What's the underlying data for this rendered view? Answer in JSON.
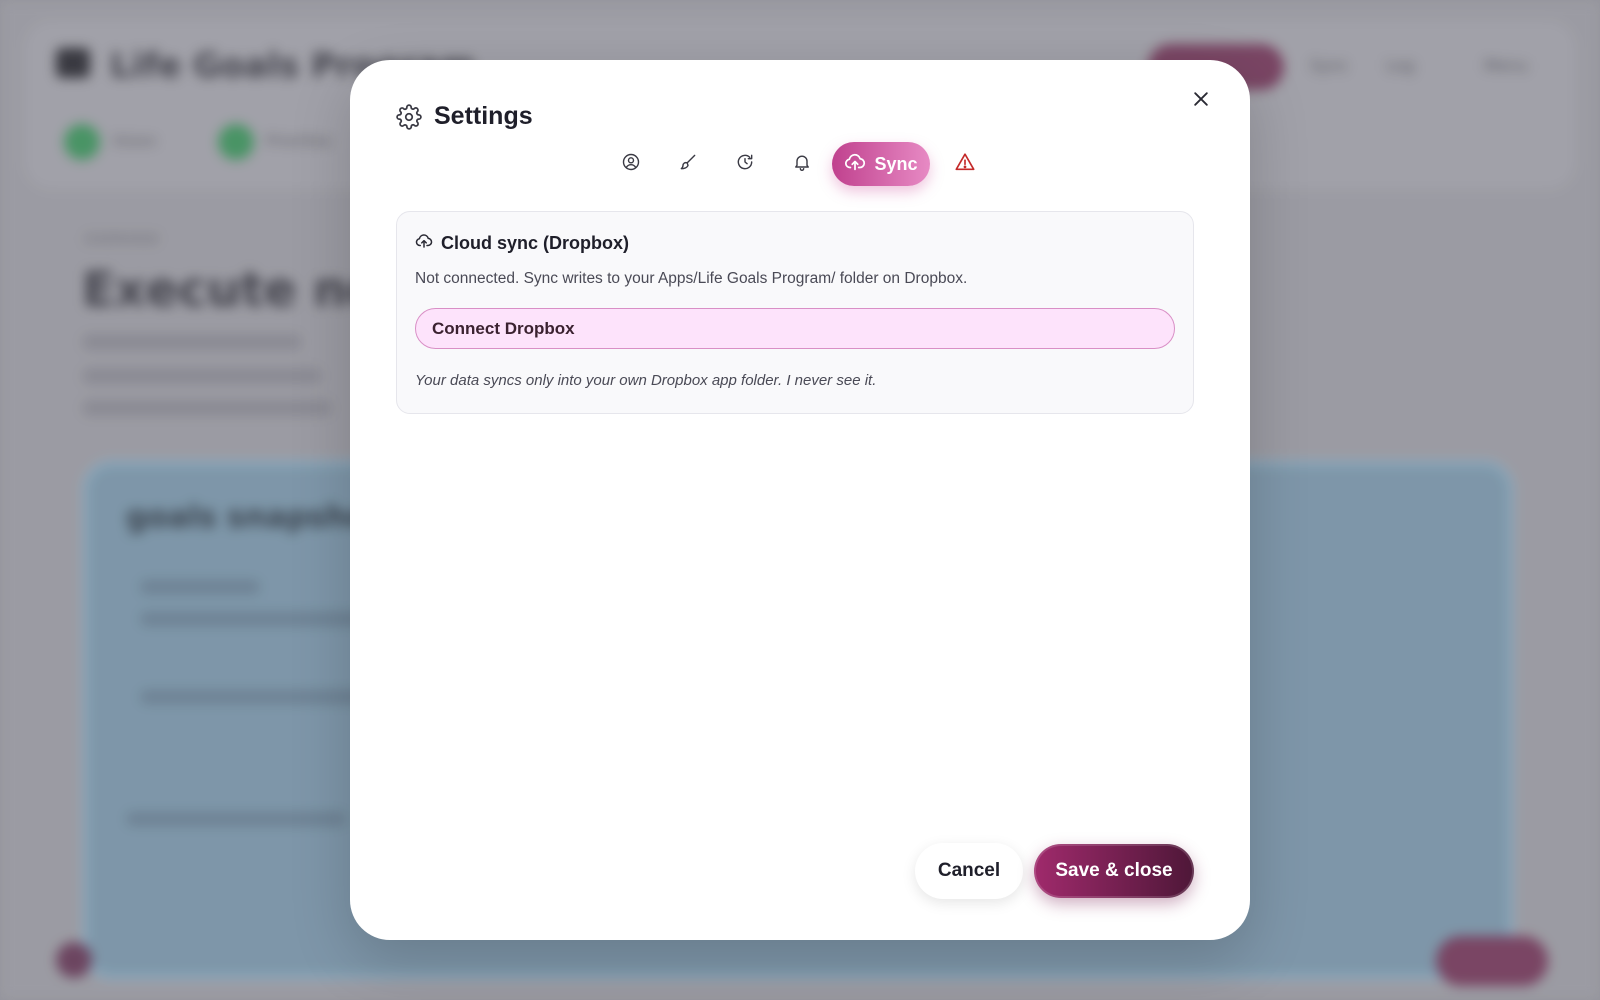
{
  "background": {
    "app_title": "Life Goals Program",
    "menu": [
      "Sync",
      "Log",
      "Menu"
    ],
    "steps": [
      "Vision",
      "Priorities"
    ],
    "section_label": "OVERVIEW",
    "heading": "Execute now",
    "card_title": "goals snapshot"
  },
  "modal": {
    "title": "Settings",
    "settings_icon": "gear-icon",
    "close_icon": "close-icon",
    "tabs": [
      {
        "icon": "user-circle-icon",
        "label": "",
        "active": false
      },
      {
        "icon": "brush-icon",
        "label": "",
        "active": false
      },
      {
        "icon": "refresh-icon",
        "label": "",
        "active": false
      },
      {
        "icon": "bell-icon",
        "label": "",
        "active": false
      },
      {
        "icon": "cloud-upload-icon",
        "label": "Sync",
        "active": true
      },
      {
        "icon": "warning-icon",
        "label": "",
        "active": false
      }
    ],
    "panel": {
      "icon": "cloud-upload-icon",
      "title": "Cloud sync (Dropbox)",
      "description": "Not connected. Sync writes to your Apps/Life Goals Program/ folder on Dropbox.",
      "connect_label": "Connect Dropbox",
      "note": "Your data syncs only into your own Dropbox app folder. I never see it."
    },
    "footer": {
      "cancel_label": "Cancel",
      "save_label": "Save & close"
    }
  },
  "colors": {
    "accent": "#c0418e",
    "accent_light": "#e78ac4",
    "save_dark": "#4e1738",
    "warning": "#c42a2a",
    "connect_bg": "#fde3fb"
  }
}
